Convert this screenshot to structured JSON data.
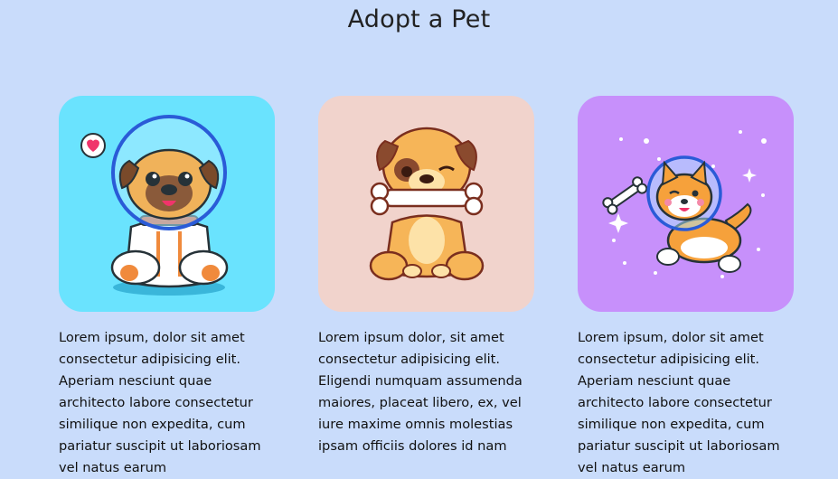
{
  "page": {
    "title": "Adopt a Pet"
  },
  "cards": [
    {
      "image_icon": "astronaut-pug-icon",
      "description": "Lorem ipsum, dolor sit amet consectetur adipisicing elit. Aperiam nesciunt quae architecto labore consectetur similique non expedita, cum pariatur suscipit ut laboriosam vel natus earum"
    },
    {
      "image_icon": "pug-with-bone-icon",
      "description": "Lorem ipsum dolor, sit amet consectetur adipisicing elit. Eligendi numquam assumenda maiores, placeat libero, ex, vel iure maxime omnis molestias ipsam officiis dolores id nam"
    },
    {
      "image_icon": "space-shiba-icon",
      "description": "Lorem ipsum, dolor sit amet consectetur adipisicing elit. Aperiam nesciunt quae architecto labore consectetur similique non expedita, cum pariatur suscipit ut laboriosam vel natus earum"
    }
  ],
  "colors": {
    "page_background": "#c9dcfb",
    "card1_background": "#6ae3fe",
    "card2_background": "#f1d3cc",
    "card3_background": "#c790fb"
  }
}
